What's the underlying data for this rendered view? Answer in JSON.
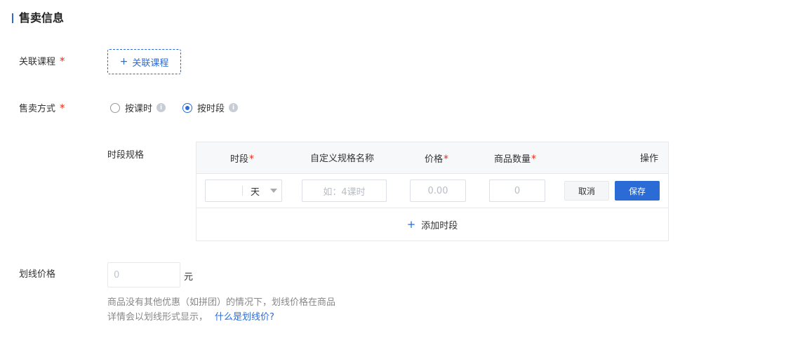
{
  "section": {
    "title": "售卖信息"
  },
  "course": {
    "label": "关联课程",
    "required": "*",
    "button_plus": "+",
    "button_label": "关联课程"
  },
  "sale_mode": {
    "label": "售卖方式",
    "required": "*",
    "options": [
      {
        "label": "按课时",
        "checked": false
      },
      {
        "label": "按时段",
        "checked": true
      }
    ],
    "info_glyph": "i"
  },
  "spec": {
    "label": "时段规格",
    "headers": {
      "period": "时段",
      "period_req": "*",
      "name": "自定义规格名称",
      "price": "价格",
      "price_req": "*",
      "qty": "商品数量",
      "qty_req": "*",
      "ops": "操作"
    },
    "row": {
      "period_unit": "天",
      "name_placeholder": "如：4课时",
      "price_placeholder": "0.00",
      "qty_placeholder": "0",
      "cancel_label": "取消",
      "save_label": "保存"
    },
    "add_plus": "+",
    "add_label": "添加时段"
  },
  "strike_price": {
    "label": "划线价格",
    "placeholder": "0",
    "unit": "元",
    "help_line1": "商品没有其他优惠（如拼团）的情况下，划线价格在商品",
    "help_line2": "详情会以划线形式显示，",
    "help_link": "什么是划线价?"
  },
  "colors": {
    "accent": "#2b6bd6",
    "required": "#e0301e"
  }
}
